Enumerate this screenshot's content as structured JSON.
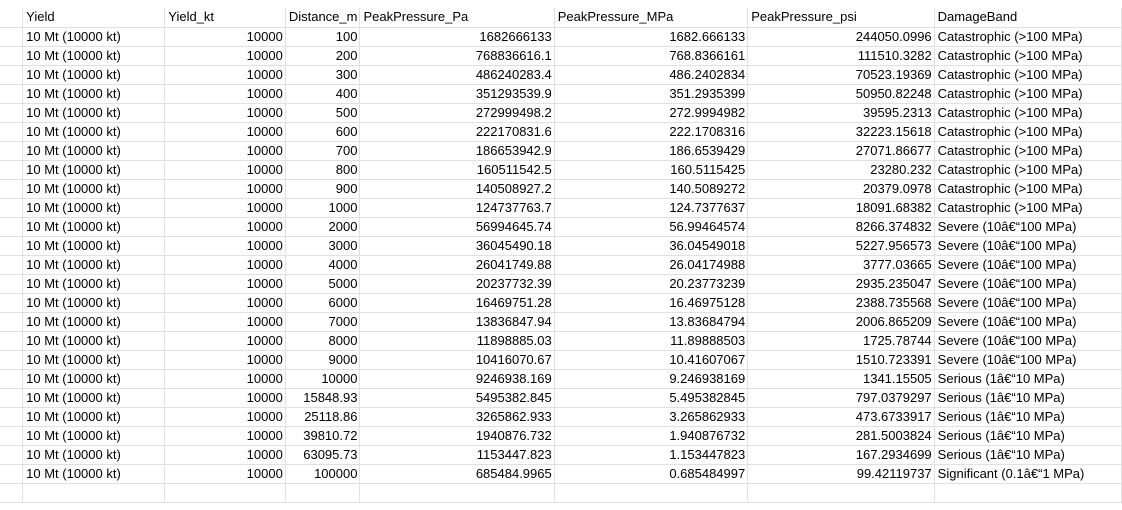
{
  "sheet": {
    "headers": [
      "Yield",
      "Yield_kt",
      "Distance_m",
      "PeakPressure_Pa",
      "PeakPressure_MPa",
      "PeakPressure_psi",
      "DamageBand"
    ],
    "rows": [
      [
        "10 Mt (10000 kt)",
        "10000",
        "100",
        "1682666133",
        "1682.666133",
        "244050.0996",
        "Catastrophic (>100 MPa)"
      ],
      [
        "10 Mt (10000 kt)",
        "10000",
        "200",
        "768836616.1",
        "768.8366161",
        "111510.3282",
        "Catastrophic (>100 MPa)"
      ],
      [
        "10 Mt (10000 kt)",
        "10000",
        "300",
        "486240283.4",
        "486.2402834",
        "70523.19369",
        "Catastrophic (>100 MPa)"
      ],
      [
        "10 Mt (10000 kt)",
        "10000",
        "400",
        "351293539.9",
        "351.2935399",
        "50950.82248",
        "Catastrophic (>100 MPa)"
      ],
      [
        "10 Mt (10000 kt)",
        "10000",
        "500",
        "272999498.2",
        "272.9994982",
        "39595.2313",
        "Catastrophic (>100 MPa)"
      ],
      [
        "10 Mt (10000 kt)",
        "10000",
        "600",
        "222170831.6",
        "222.1708316",
        "32223.15618",
        "Catastrophic (>100 MPa)"
      ],
      [
        "10 Mt (10000 kt)",
        "10000",
        "700",
        "186653942.9",
        "186.6539429",
        "27071.86677",
        "Catastrophic (>100 MPa)"
      ],
      [
        "10 Mt (10000 kt)",
        "10000",
        "800",
        "160511542.5",
        "160.5115425",
        "23280.232",
        "Catastrophic (>100 MPa)"
      ],
      [
        "10 Mt (10000 kt)",
        "10000",
        "900",
        "140508927.2",
        "140.5089272",
        "20379.0978",
        "Catastrophic (>100 MPa)"
      ],
      [
        "10 Mt (10000 kt)",
        "10000",
        "1000",
        "124737763.7",
        "124.7377637",
        "18091.68382",
        "Catastrophic (>100 MPa)"
      ],
      [
        "10 Mt (10000 kt)",
        "10000",
        "2000",
        "56994645.74",
        "56.99464574",
        "8266.374832",
        "Severe (10â€“100 MPa)"
      ],
      [
        "10 Mt (10000 kt)",
        "10000",
        "3000",
        "36045490.18",
        "36.04549018",
        "5227.956573",
        "Severe (10â€“100 MPa)"
      ],
      [
        "10 Mt (10000 kt)",
        "10000",
        "4000",
        "26041749.88",
        "26.04174988",
        "3777.03665",
        "Severe (10â€“100 MPa)"
      ],
      [
        "10 Mt (10000 kt)",
        "10000",
        "5000",
        "20237732.39",
        "20.23773239",
        "2935.235047",
        "Severe (10â€“100 MPa)"
      ],
      [
        "10 Mt (10000 kt)",
        "10000",
        "6000",
        "16469751.28",
        "16.46975128",
        "2388.735568",
        "Severe (10â€“100 MPa)"
      ],
      [
        "10 Mt (10000 kt)",
        "10000",
        "7000",
        "13836847.94",
        "13.83684794",
        "2006.865209",
        "Severe (10â€“100 MPa)"
      ],
      [
        "10 Mt (10000 kt)",
        "10000",
        "8000",
        "11898885.03",
        "11.89888503",
        "1725.78744",
        "Severe (10â€“100 MPa)"
      ],
      [
        "10 Mt (10000 kt)",
        "10000",
        "9000",
        "10416070.67",
        "10.41607067",
        "1510.723391",
        "Severe (10â€“100 MPa)"
      ],
      [
        "10 Mt (10000 kt)",
        "10000",
        "10000",
        "9246938.169",
        "9.246938169",
        "1341.15505",
        "Serious (1â€“10 MPa)"
      ],
      [
        "10 Mt (10000 kt)",
        "10000",
        "15848.93",
        "5495382.845",
        "5.495382845",
        "797.0379297",
        "Serious (1â€“10 MPa)"
      ],
      [
        "10 Mt (10000 kt)",
        "10000",
        "25118.86",
        "3265862.933",
        "3.265862933",
        "473.6733917",
        "Serious (1â€“10 MPa)"
      ],
      [
        "10 Mt (10000 kt)",
        "10000",
        "39810.72",
        "1940876.732",
        "1.940876732",
        "281.5003824",
        "Serious (1â€“10 MPa)"
      ],
      [
        "10 Mt (10000 kt)",
        "10000",
        "63095.73",
        "1153447.823",
        "1.153447823",
        "167.2934699",
        "Serious (1â€“10 MPa)"
      ],
      [
        "10 Mt (10000 kt)",
        "10000",
        "100000",
        "685484.9965",
        "0.685484997",
        "99.42119737",
        "Significant (0.1â€“1 MPa)"
      ]
    ]
  }
}
